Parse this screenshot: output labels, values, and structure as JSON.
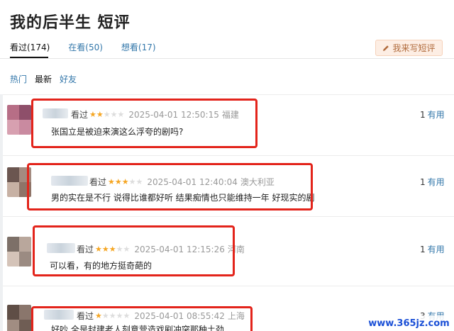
{
  "header": {
    "title": "我的后半生 短评"
  },
  "tabs": [
    {
      "label": "看过(174)",
      "active": true
    },
    {
      "label": "在看(50)",
      "active": false
    },
    {
      "label": "想看(17)",
      "active": false
    }
  ],
  "write_button": {
    "label": "我来写短评",
    "icon": "pencil-icon"
  },
  "subfilters": [
    {
      "label": "热门"
    },
    {
      "label": "最新"
    },
    {
      "label": "好友"
    }
  ],
  "reviews": [
    {
      "status": "看过",
      "rating": 2,
      "time": "2025-04-01 12:50:15",
      "location": "福建",
      "content": "张国立是被迫来演这么浮夸的剧吗?",
      "useful_count": "1",
      "useful_label": "有用"
    },
    {
      "status": "看过",
      "rating": 3,
      "time": "2025-04-01 12:40:04",
      "location": "澳大利亚",
      "content": "男的实在是不行 说得比谁都好听 结果痴情也只能维持一年 好现实的剧",
      "useful_count": "1",
      "useful_label": "有用"
    },
    {
      "status": "看过",
      "rating": 3,
      "time": "2025-04-01 12:15:26",
      "location": "河南",
      "content": "可以看，有的地方挺奇葩的",
      "useful_count": "1",
      "useful_label": "有用"
    },
    {
      "status": "看过",
      "rating": 1,
      "time": "2025-04-01 08:55:42",
      "location": "上海",
      "content": "好吵 全是封建老人刻意营造戏剧冲突那种土劲",
      "useful_count": "3",
      "useful_label": "有用"
    }
  ],
  "watermark": "www.365jz.com",
  "colors": {
    "link": "#3377aa",
    "star": "#f5a623",
    "highlight_box": "#e3241b",
    "button_bg": "#fdeee4"
  }
}
